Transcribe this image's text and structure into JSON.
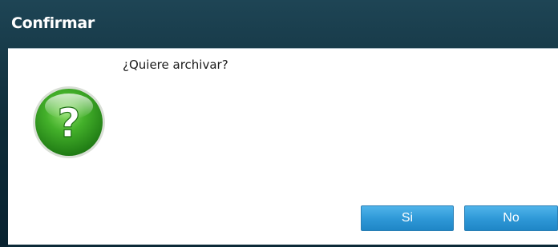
{
  "dialog": {
    "title": "Confirmar",
    "message": "¿Quiere archivar?",
    "icon": "question-icon",
    "buttons": {
      "yes_label": "Si",
      "no_label": "No"
    }
  },
  "colors": {
    "title_bar": "#0f2c39",
    "button": "#2d97d6",
    "icon_green": "#3aa32a"
  }
}
